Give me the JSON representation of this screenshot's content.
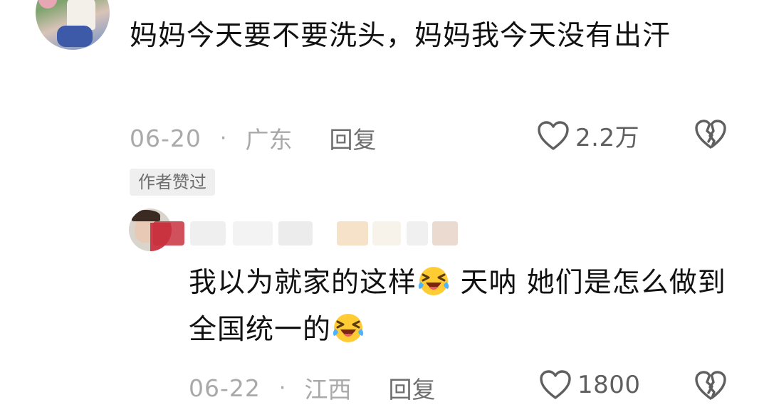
{
  "comment": {
    "text": "妈妈今天要不要洗头，妈妈我今天没有出汗",
    "date": "06-20",
    "separator": "·",
    "location": "广东",
    "reply_label": "回复",
    "like_count": "2.2万",
    "badge": "作者赞过"
  },
  "reply": {
    "text_part1": "我以为就家的这样",
    "text_part2": " 天呐  她们是怎么做到全国统一的",
    "date": "06-22",
    "separator": "·",
    "location": "江西",
    "reply_label": "回复",
    "like_count": "1800",
    "emoji": "laughing-crying-emoji"
  },
  "icons": {
    "like": "heart-outline-icon",
    "dislike": "broken-heart-icon"
  },
  "colors": {
    "text_primary": "#111111",
    "text_meta": "#a9a9a9",
    "text_secondary": "#6e6e6e",
    "badge_bg": "#efefef"
  }
}
